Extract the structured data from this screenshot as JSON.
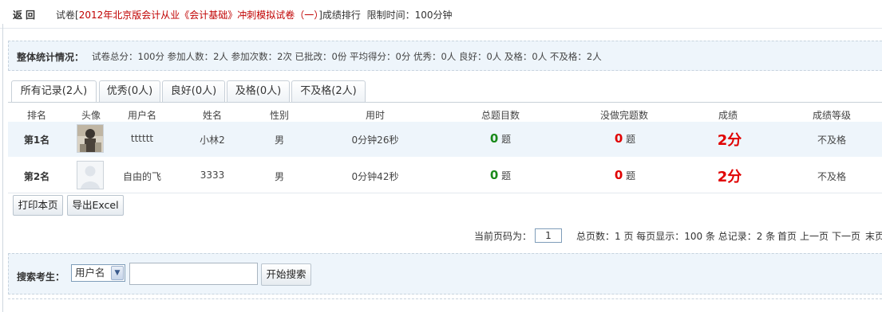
{
  "header": {
    "back_label": "返回",
    "exam_prefix": "试卷[",
    "exam_name": "2012年北京版会计从业《会计基础》冲刺模拟试卷（一）",
    "exam_suffix": "]成绩排行",
    "time_limit": "限制时间：100分钟"
  },
  "summary": {
    "label": "整体统计情况：",
    "stats": "试卷总分：100分  参加人数：2人  参加次数：2次  已批改：0份  平均得分：0分  优秀：0人  良好：0人  及格：0人  不及格：2人"
  },
  "tabs": [
    {
      "label": "所有记录(2人)",
      "active": true
    },
    {
      "label": "优秀(0人)",
      "active": false
    },
    {
      "label": "良好(0人)",
      "active": false
    },
    {
      "label": "及格(0人)",
      "active": false
    },
    {
      "label": "不及格(2人)",
      "active": false
    }
  ],
  "table": {
    "columns": [
      "排名",
      "头像",
      "用户名",
      "姓名",
      "性别",
      "用时",
      "总题目数",
      "没做完题数",
      "成绩",
      "成绩等级"
    ],
    "rows": [
      {
        "rank": "第1名",
        "username": "tttttt",
        "name": "小林2",
        "gender": "男",
        "time": "0分钟26秒",
        "total_q": "0",
        "unit_q": "题",
        "undone": "0",
        "unit_u": "题",
        "score": "2分",
        "grade": "不及格"
      },
      {
        "rank": "第2名",
        "username": "自由的飞",
        "name": "3333",
        "gender": "男",
        "time": "0分钟42秒",
        "total_q": "0",
        "unit_q": "题",
        "undone": "0",
        "unit_u": "题",
        "score": "2分",
        "grade": "不及格"
      }
    ]
  },
  "buttons": {
    "print": "打印本页",
    "export": "导出Excel",
    "search": "开始搜索"
  },
  "pager": {
    "current_label": "当前页码为：",
    "current_page": "1",
    "info": "总页数：1 页  每页显示：100 条  总记录：2 条",
    "first": "首页",
    "prev": "上一页",
    "next": "下一页",
    "last": "末页"
  },
  "search": {
    "label": "搜索考生：",
    "field_option": "用户名"
  },
  "colors": {
    "accent_red": "#c00000",
    "score_red": "#e00000",
    "count_green": "#1a8a1a",
    "panel_bg": "#eef5fb"
  }
}
